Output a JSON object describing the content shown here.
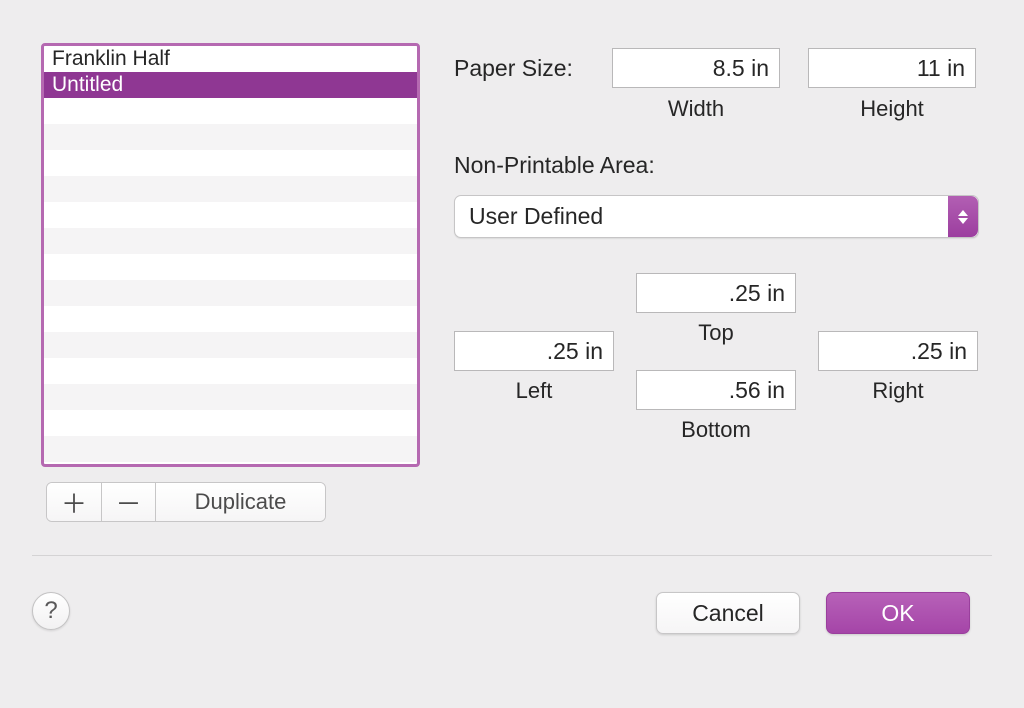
{
  "paper_list": {
    "items": [
      {
        "label": "Franklin Half",
        "selected": false
      },
      {
        "label": "Untitled",
        "selected": true
      }
    ],
    "toolbar": {
      "add_glyph": "＋",
      "remove_glyph": "－",
      "duplicate_label": "Duplicate"
    }
  },
  "labels": {
    "paper_size": "Paper Size:",
    "width": "Width",
    "height": "Height",
    "non_printable": "Non-Printable Area:",
    "top": "Top",
    "left": "Left",
    "right": "Right",
    "bottom": "Bottom"
  },
  "paper_size": {
    "width": "8.5 in",
    "height": "11 in"
  },
  "non_printable": {
    "popup_value": "User Defined",
    "top": ".25 in",
    "left": ".25 in",
    "right": ".25 in",
    "bottom": ".56 in"
  },
  "buttons": {
    "cancel": "Cancel",
    "ok": "OK",
    "help": "?"
  },
  "colors": {
    "accent": "#9c3e9f",
    "selection": "#8f3793"
  }
}
